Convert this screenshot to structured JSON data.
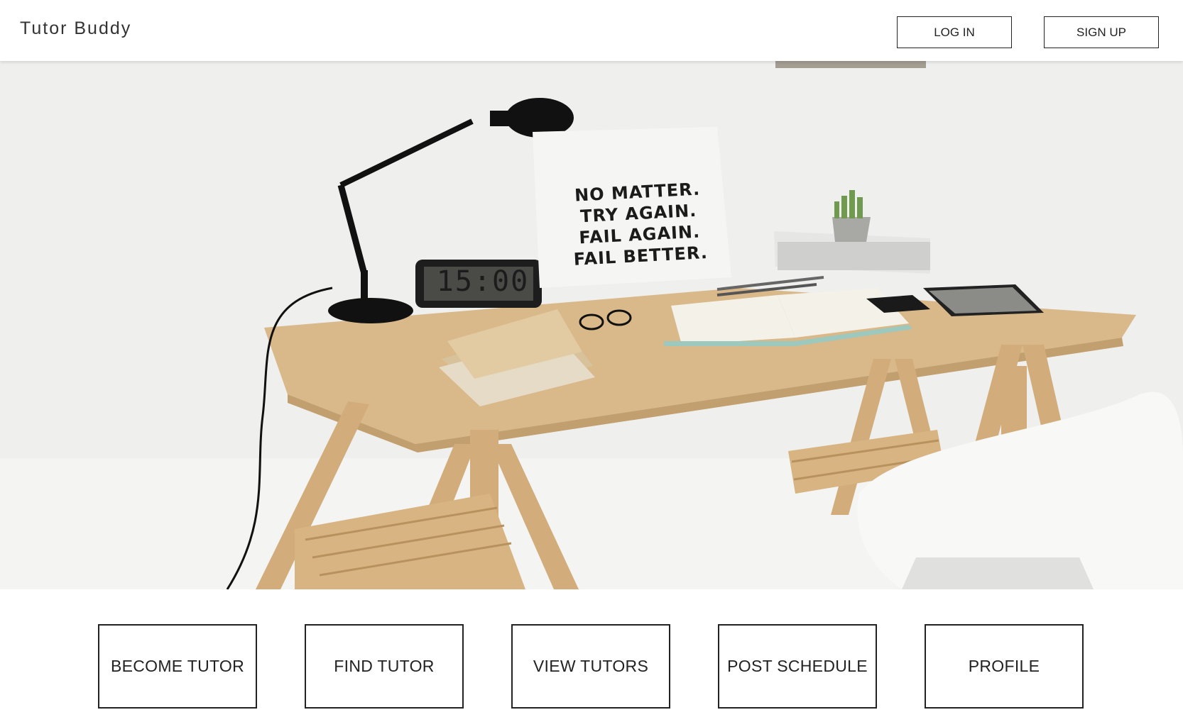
{
  "header": {
    "brand": "Tutor Buddy",
    "login_label": "LOG IN",
    "signup_label": "SIGN UP"
  },
  "hero": {
    "poster_lines": [
      "NO MATTER.",
      "TRY AGAIN.",
      "FAIL AGAIN.",
      "FAIL BETTER."
    ],
    "clock_text": "15:00"
  },
  "nav": {
    "items": [
      {
        "label": "BECOME TUTOR"
      },
      {
        "label": "FIND TUTOR"
      },
      {
        "label": "VIEW TUTORS"
      },
      {
        "label": "POST SCHEDULE"
      },
      {
        "label": "PROFILE"
      }
    ]
  },
  "colors": {
    "wall": "#efefed",
    "wood": "#d9b88a",
    "text": "#222222"
  }
}
